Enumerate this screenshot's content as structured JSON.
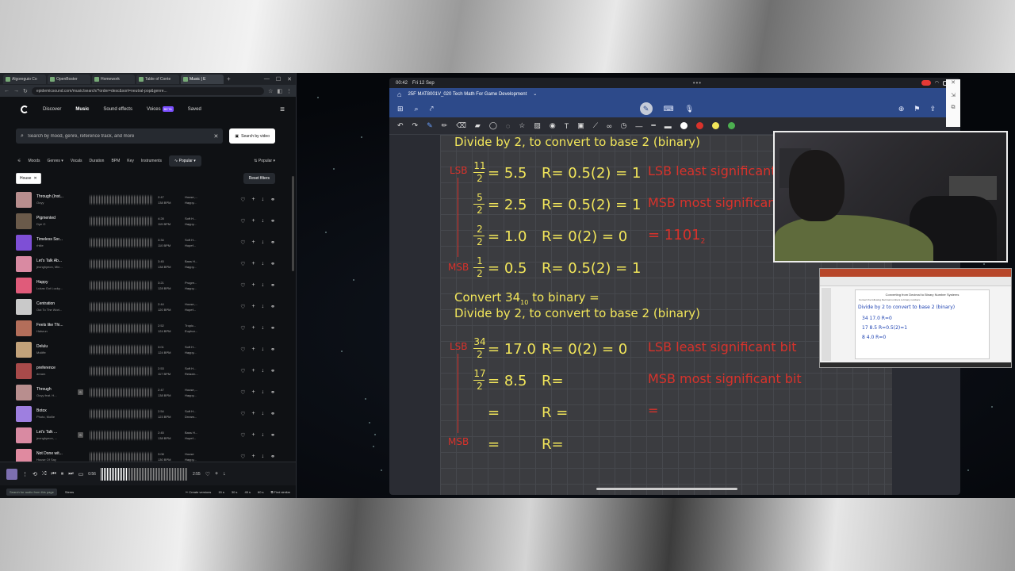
{
  "browser": {
    "tabs": [
      {
        "label": "Algoreguio Co",
        "active": false
      },
      {
        "label": "OpenBoster",
        "active": false
      },
      {
        "label": "Homework",
        "active": false
      },
      {
        "label": "Table of Conte",
        "active": false
      },
      {
        "label": "Music | E",
        "active": true
      }
    ],
    "url": "epidemicsound.com/music/search/?order=desc&sort=neutral-pop&genre..."
  },
  "app": {
    "nav": [
      "Discover",
      "Music",
      "Sound effects",
      "Voices",
      "Saved"
    ],
    "voices_badge": "BETA",
    "search_placeholder": "Search by mood, genre, reference track, and more",
    "search_by_video": "Search by video",
    "filters": [
      "Moods",
      "Genres",
      "Vocals",
      "Duration",
      "BPM",
      "Key",
      "Instruments"
    ],
    "sort_chip": "Popular",
    "sort_right": "Popular",
    "active_chip": "House",
    "reset_filters": "Reset filters"
  },
  "tracks": [
    {
      "title": "Through (Inst...",
      "artist": "Ooyy",
      "dur": "2:47",
      "bpm": "138 BPM",
      "g1": "House,...",
      "g2": "Happy...",
      "color": "#b88e8e",
      "e": false
    },
    {
      "title": "Pigmented",
      "artist": "Dye O",
      "dur": "4:28",
      "bpm": "115 BPM",
      "g1": "Soft H...",
      "g2": "Happy...",
      "color": "#6a5a4a",
      "e": false
    },
    {
      "title": "Timeless Sor...",
      "artist": "rhtiie",
      "dur": "3:34",
      "bpm": "110 BPM",
      "g1": "Soft H...",
      "g2": "Hopef...",
      "color": "#7e4fd6",
      "e": false
    },
    {
      "title": "Let's Talk Ab...",
      "artist": "jeonghyeon, Min...",
      "dur": "3:45",
      "bpm": "138 BPM",
      "g1": "Bass H...",
      "g2": "Happy...",
      "color": "#d98aa2",
      "e": false
    },
    {
      "title": "Happy",
      "artist": "Lukas Got Lucky...",
      "dur": "3:21",
      "bpm": "128 BPM",
      "g1": "Progre...",
      "g2": "Happy...",
      "color": "#e05b7a",
      "e": false
    },
    {
      "title": "Centration",
      "artist": "Out To The Worl...",
      "dur": "2:44",
      "bpm": "120 BPM",
      "g1": "House,...",
      "g2": "Hopef...",
      "color": "#c9c9c9",
      "e": false
    },
    {
      "title": "Feels like Thi...",
      "artist": "Halsrun",
      "dur": "2:52",
      "bpm": "124 BPM",
      "g1": "Tropic...",
      "g2": "Euphor...",
      "color": "#b36e5a",
      "e": false
    },
    {
      "title": "Delulu",
      "artist": "Moliffe",
      "dur": "3:01",
      "bpm": "124 BPM",
      "g1": "Soft H...",
      "g2": "Happy...",
      "color": "#c2a27a",
      "e": false
    },
    {
      "title": "preference",
      "artist": "dream",
      "dur": "2:53",
      "bpm": "117 BPM",
      "g1": "Soft H...",
      "g2": "Relaxin...",
      "color": "#a84a4a",
      "e": false
    },
    {
      "title": "Through",
      "artist": "Ooyy feat. H...",
      "dur": "2:47",
      "bpm": "138 BPM",
      "g1": "House,...",
      "g2": "Happy...",
      "color": "#b88e8e",
      "e": true
    },
    {
      "title": "Botox",
      "artist": "Photo, Mollie",
      "dur": "2:54",
      "bpm": "123 BPM",
      "g1": "Soft H...",
      "g2": "Dream...",
      "color": "#9e7fe0",
      "e": false
    },
    {
      "title": "Let's Talk ...",
      "artist": "jeonghyeon, ...",
      "dur": "2:45",
      "bpm": "138 BPM",
      "g1": "Bass H...",
      "g2": "Hopef...",
      "color": "#d98aa2",
      "e": true
    },
    {
      "title": "Not Done wit...",
      "artist": "House Of Say",
      "dur": "3:08",
      "bpm": "130 BPM",
      "g1": "House",
      "g2": "Happy...",
      "color": "#e08aa0",
      "e": false
    }
  ],
  "player": {
    "current": "0:56",
    "total": "2:55",
    "progress": 0.3
  },
  "bottom": {
    "hint": "Search for audio from this page",
    "stems": "Stems",
    "create_versions": "Create versions",
    "lens": [
      "15 s",
      "30 s",
      "45 s",
      "60 s"
    ],
    "find_similar": "Find similar"
  },
  "tablet": {
    "time": "00:42",
    "date": "Fri 12 Sep",
    "doc_title": "25F MAT8001V_020 Tech Math For Game Development",
    "colors": {
      "yellow": "#f2e65a",
      "red": "#d8322b",
      "white": "#ffffff",
      "green": "#4caf50"
    }
  },
  "notes": {
    "line1": "Divide by 2, to convert to base 2 (binary)",
    "rows_a": [
      {
        "num": "11",
        "den": "2",
        "res": "5.5",
        "r": "R= 0.5(2) = 1"
      },
      {
        "num": "5",
        "den": "2",
        "res": "2.5",
        "r": "R= 0.5(2) = 1"
      },
      {
        "num": "2",
        "den": "2",
        "res": "1.0",
        "r": "R= 0(2) = 0"
      },
      {
        "num": "1",
        "den": "2",
        "res": "0.5",
        "r": "R= 0.5(2) = 1"
      }
    ],
    "lsb_a": "LSB least significant bit",
    "msb_a": "MSB most significant bit",
    "eq_a": "= 1101",
    "eq_a_sub": "2",
    "convert_line": "Convert 34",
    "convert_sub": "10",
    "convert_rest": "to binary =",
    "line2": "Divide by 2, to convert to base 2 (binary)",
    "rows_b": [
      {
        "num": "34",
        "den": "2",
        "res": "17.0",
        "r": "R= 0(2) = 0"
      },
      {
        "num": "17",
        "den": "2",
        "res": "8.5",
        "r": "R="
      },
      {
        "num": "",
        "den": "",
        "res": "=",
        "r": "R ="
      },
      {
        "num": "",
        "den": "",
        "res": "=",
        "r": "R="
      }
    ],
    "lsb_b": "LSB least significant bit",
    "msb_b": "MSB most significant bit",
    "eq_b": "=",
    "lsb_label": "LSB",
    "msb_label": "MSB"
  },
  "ppt": {
    "title": "Converting from Decimal to Binary Number Systems",
    "subtitle": "Convert the following Decimal numbers to binary numbers:",
    "ink1": "Divide by 2 to convert to base 2 (binary)",
    "ink2": "34  17.0   R=0",
    "ink3": "17  8.5   R=0.5(2)=1",
    "ink4": "8  4.0   R=0"
  }
}
